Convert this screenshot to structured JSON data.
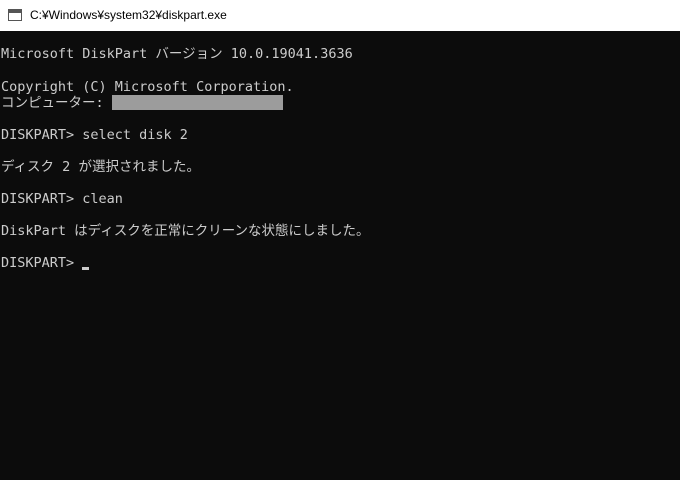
{
  "window": {
    "title": "C:¥Windows¥system32¥diskpart.exe"
  },
  "console": {
    "lines": [
      "Microsoft DiskPart バージョン 10.0.19041.3636",
      "Copyright (C) Microsoft Corporation.",
      "コンピューター: ",
      "DISKPART> select disk 2",
      "ディスク 2 が選択されました。",
      "DISKPART> clean",
      "DiskPart はディスクを正常にクリーンな状態にしました。",
      "DISKPART> "
    ]
  },
  "colors": {
    "console_background": "#0c0c0c",
    "console_text": "#cccccc",
    "titlebar_background": "#ffffff",
    "redaction": "#9c9c9c"
  }
}
